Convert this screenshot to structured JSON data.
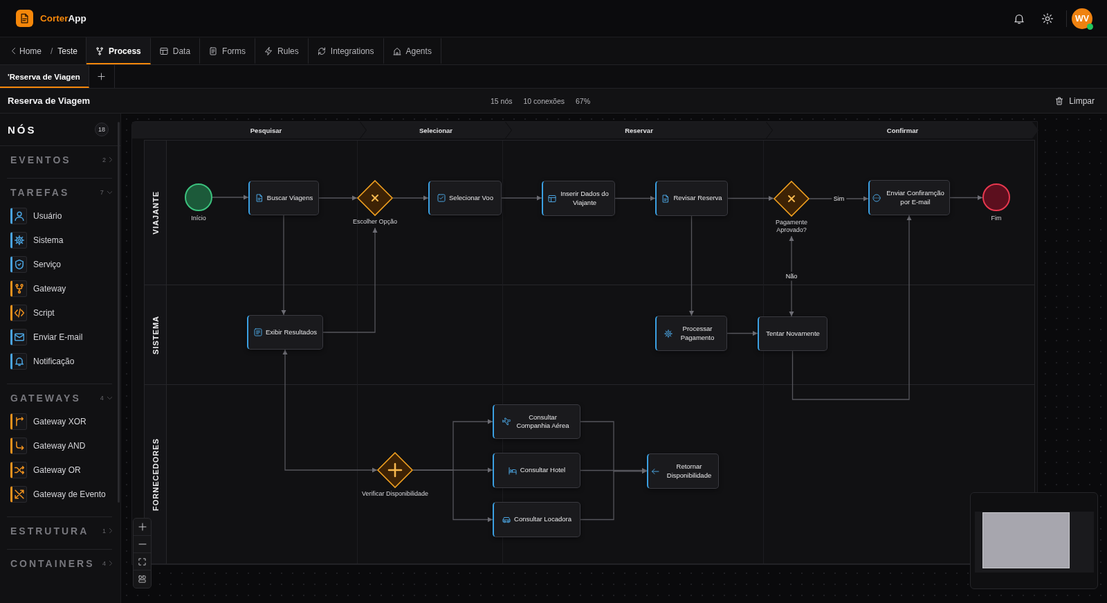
{
  "header": {
    "brand": {
      "accent": "Corter",
      "rest": "App"
    },
    "user": {
      "initials": "WV",
      "online": true
    }
  },
  "breadcrumb": {
    "back": "Home",
    "separator": "/",
    "current": "Teste"
  },
  "tabs": [
    {
      "label": "Process",
      "selected": true
    },
    {
      "label": "Data",
      "selected": false
    },
    {
      "label": "Forms",
      "selected": false
    },
    {
      "label": "Rules",
      "selected": false
    },
    {
      "label": "Integrations",
      "selected": false
    },
    {
      "label": "Agents",
      "selected": false
    }
  ],
  "documents": [
    {
      "label": "'Reserva de Viagen",
      "selected": true
    }
  ],
  "toolbar": {
    "title": "Reserva de Viagem",
    "stats": [
      "15 nós",
      "10 conexões",
      "67%"
    ],
    "clear_button": "Limpar"
  },
  "sidebar": {
    "title": "NÓS",
    "count": "18",
    "sections": [
      {
        "title": "EVENTOS",
        "count": "2",
        "expanded": false
      },
      {
        "title": "TAREFAS",
        "count": "7",
        "expanded": true,
        "items": [
          {
            "label": "Usuário",
            "kind": "user",
            "color": "#4aa3df"
          },
          {
            "label": "Sistema",
            "kind": "system",
            "color": "#4aa3df"
          },
          {
            "label": "Serviço",
            "kind": "service",
            "color": "#4aa3df"
          },
          {
            "label": "Gateway",
            "kind": "gateway",
            "color": "#f0921e"
          },
          {
            "label": "Script",
            "kind": "script",
            "color": "#f0921e"
          },
          {
            "label": "Enviar E-mail",
            "kind": "email",
            "color": "#4aa3df"
          },
          {
            "label": "Notificação",
            "kind": "notification",
            "color": "#4aa3df"
          }
        ]
      },
      {
        "title": "GATEWAYS",
        "count": "4",
        "expanded": true,
        "items": [
          {
            "label": "Gateway XOR",
            "kind": "xor",
            "color": "#f0921e"
          },
          {
            "label": "Gateway AND",
            "kind": "and",
            "color": "#f0921e"
          },
          {
            "label": "Gateway OR",
            "kind": "or",
            "color": "#f0921e"
          },
          {
            "label": "Gateway de Evento",
            "kind": "event",
            "color": "#f0921e"
          }
        ]
      },
      {
        "title": "ESTRUTURA",
        "count": "1",
        "expanded": false
      },
      {
        "title": "CONTAINERS",
        "count": "4",
        "expanded": false
      }
    ]
  },
  "diagram": {
    "phases": [
      "Pesquisar",
      "Selecionar",
      "Reservar",
      "Confirmar"
    ],
    "lanes": [
      "VIAJANTE",
      "SISTEMA",
      "FORNECEDORES"
    ],
    "nodes": [
      {
        "kind": "start",
        "label": "Início"
      },
      {
        "kind": "task",
        "label": "Buscar Viagens"
      },
      {
        "kind": "xor",
        "label": "Escolher Opção"
      },
      {
        "kind": "task",
        "label": "Selecionar Voo"
      },
      {
        "kind": "task",
        "label": "Inserir Dados do Viajante"
      },
      {
        "kind": "task",
        "label": "Revisar Reserva"
      },
      {
        "kind": "xor",
        "label": "Pagamente Aprovado?",
        "branch_labels": [
          "Sim",
          "Não"
        ]
      },
      {
        "kind": "task",
        "label": "Enviar Confiramção por E-mail"
      },
      {
        "kind": "end",
        "label": "Fim"
      },
      {
        "kind": "task",
        "label": "Exibir Resultados"
      },
      {
        "kind": "task",
        "label": "Processar Pagamento"
      },
      {
        "kind": "task",
        "label": "Tentar Novamente"
      },
      {
        "kind": "and",
        "label": "Verificar Disponibilidade"
      },
      {
        "kind": "task",
        "label": "Consultar Companhia Aérea"
      },
      {
        "kind": "task",
        "label": "Consultar Hotel"
      },
      {
        "kind": "task",
        "label": "Consultar Locadora"
      },
      {
        "kind": "task",
        "label": "Retornar Disponibilidade"
      }
    ]
  }
}
